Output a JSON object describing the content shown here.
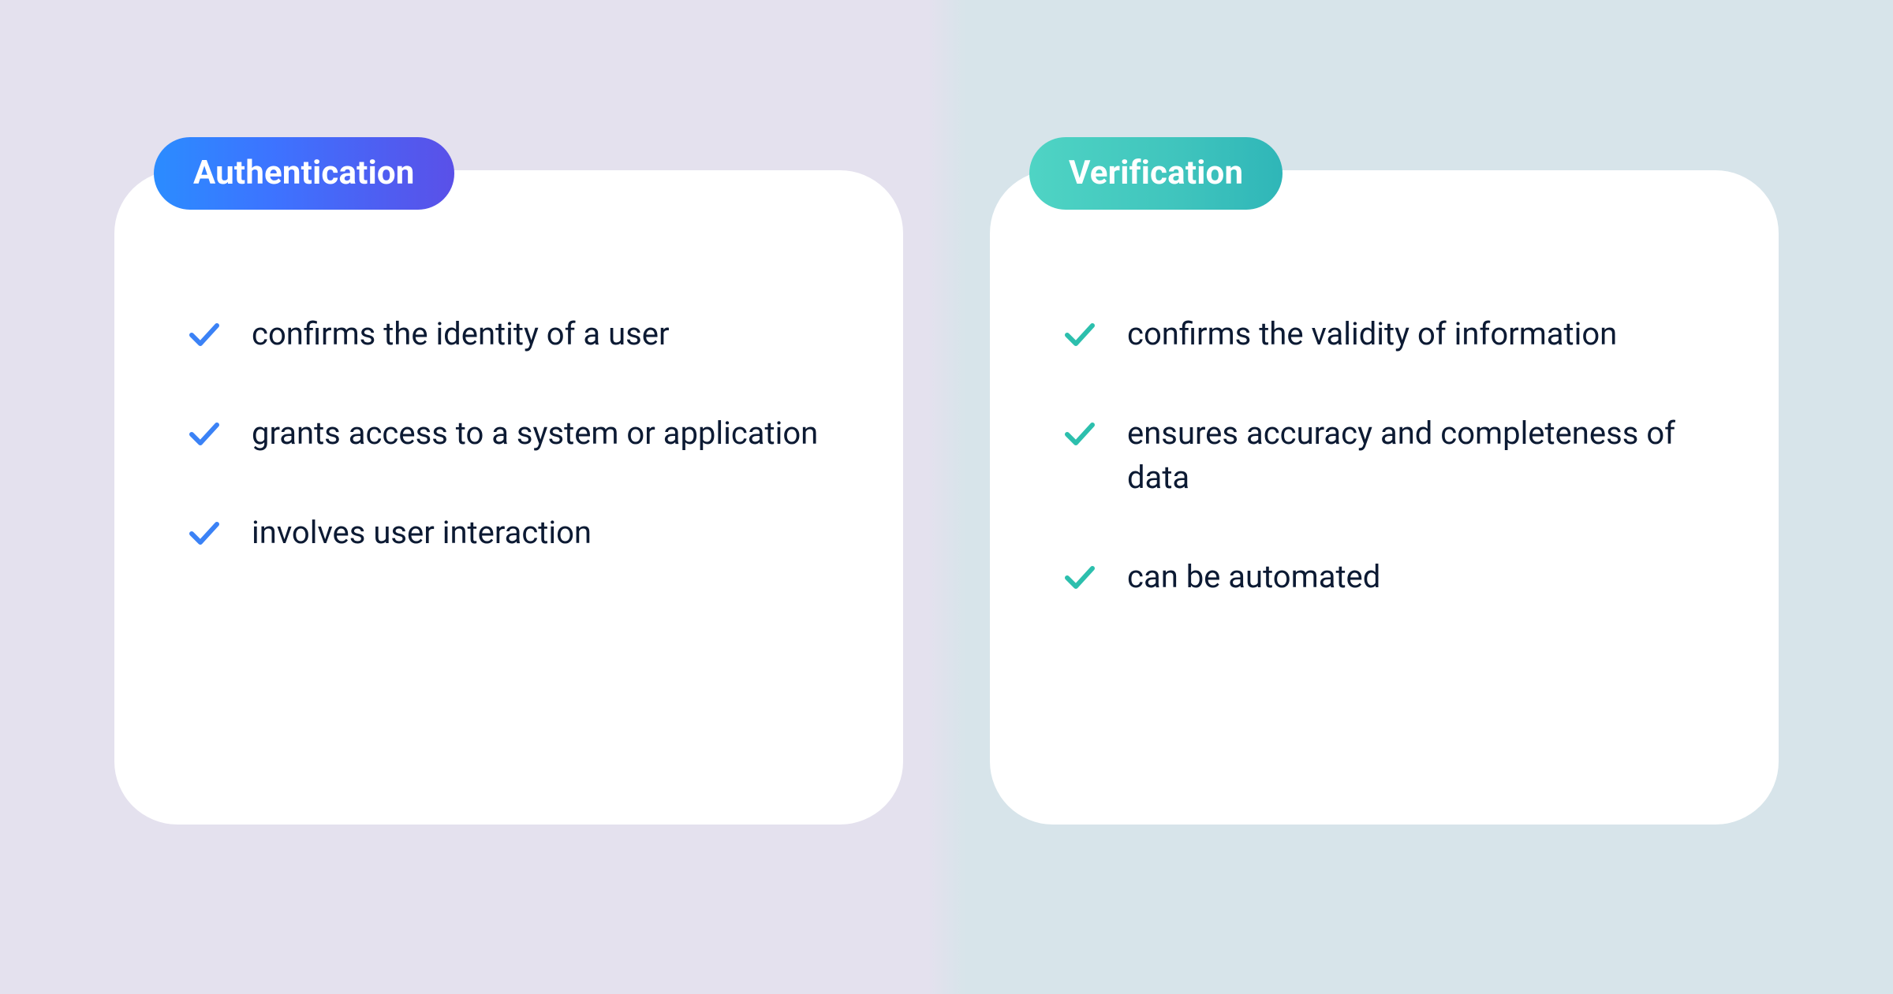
{
  "colors": {
    "auth_check": "#3b82f6",
    "verif_check": "#2cbfad",
    "text": "#0c1a33"
  },
  "cards": {
    "authentication": {
      "title": "Authentication",
      "items": [
        "confirms the identity of a user",
        "grants access to a system or application",
        "involves user interaction"
      ]
    },
    "verification": {
      "title": "Verification",
      "items": [
        "confirms the validity of information",
        "ensures accuracy and completeness of data",
        "can be automated"
      ]
    }
  }
}
